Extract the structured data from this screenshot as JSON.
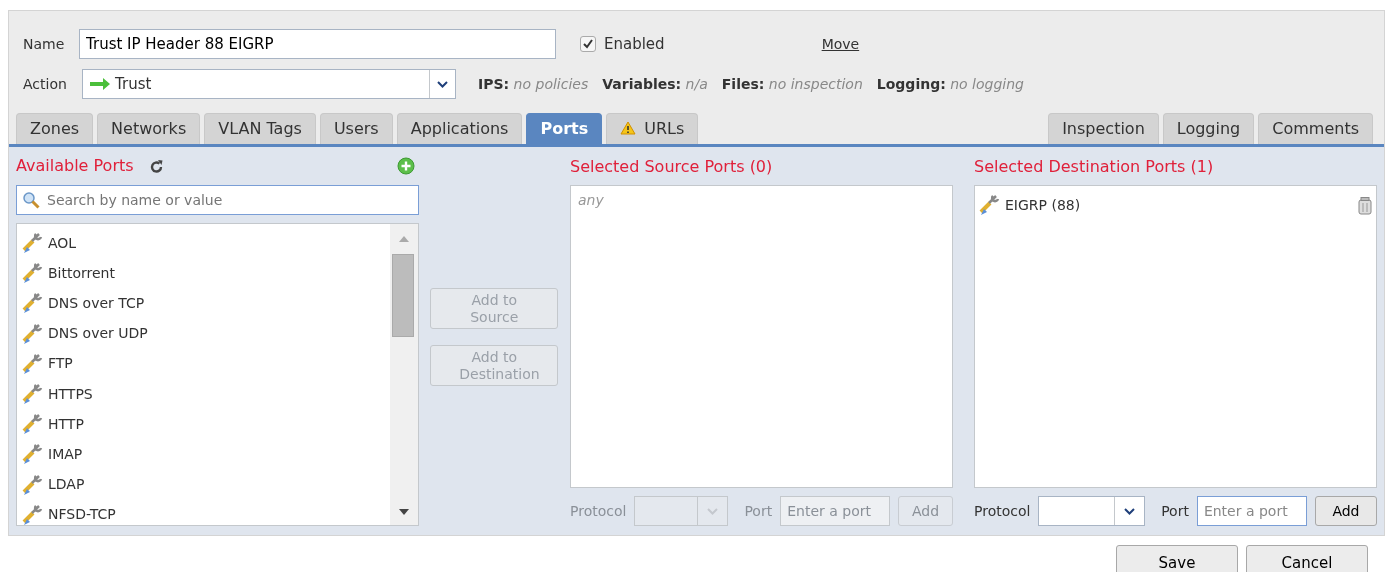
{
  "rule": {
    "name_label": "Name",
    "name_value": "Trust IP Header 88 EIGRP",
    "enabled": {
      "label": "Enabled",
      "checked": true
    },
    "move_link": "Move",
    "action_label": "Action",
    "action_value": "Trust",
    "summary": [
      {
        "label": "IPS:",
        "value": "no policies"
      },
      {
        "label": "Variables:",
        "value": "n/a"
      },
      {
        "label": "Files:",
        "value": "no inspection"
      },
      {
        "label": "Logging:",
        "value": "no logging"
      }
    ]
  },
  "tabs_left": [
    {
      "label": "Zones",
      "selected": false,
      "warning": false
    },
    {
      "label": "Networks",
      "selected": false,
      "warning": false
    },
    {
      "label": "VLAN Tags",
      "selected": false,
      "warning": false
    },
    {
      "label": "Users",
      "selected": false,
      "warning": false
    },
    {
      "label": "Applications",
      "selected": false,
      "warning": false
    },
    {
      "label": "Ports",
      "selected": true,
      "warning": false
    },
    {
      "label": "URLs",
      "selected": false,
      "warning": true
    }
  ],
  "tabs_right": [
    {
      "label": "Inspection",
      "selected": false
    },
    {
      "label": "Logging",
      "selected": false
    },
    {
      "label": "Comments",
      "selected": false
    }
  ],
  "available": {
    "title": "Available Ports",
    "search_placeholder": "Search by name or value",
    "items": [
      "AOL",
      "Bittorrent",
      "DNS over TCP",
      "DNS over UDP",
      "FTP",
      "HTTPS",
      "HTTP",
      "IMAP",
      "LDAP",
      "NFSD-TCP"
    ]
  },
  "add_buttons": [
    {
      "label": "Add to Source",
      "disabled": true
    },
    {
      "label": "Add to Destination",
      "disabled": true
    }
  ],
  "source": {
    "title": "Selected Source Ports (0)",
    "empty_text": "any",
    "protocol_label": "Protocol",
    "port_label": "Port",
    "port_placeholder": "Enter a port",
    "add_label": "Add",
    "disabled": true
  },
  "destination": {
    "title": "Selected Destination Ports (1)",
    "items": [
      "EIGRP (88)"
    ],
    "protocol_label": "Protocol",
    "port_label": "Port",
    "port_placeholder": "Enter a port",
    "add_label": "Add",
    "disabled": false
  },
  "footer_buttons": [
    "Save",
    "Cancel"
  ]
}
